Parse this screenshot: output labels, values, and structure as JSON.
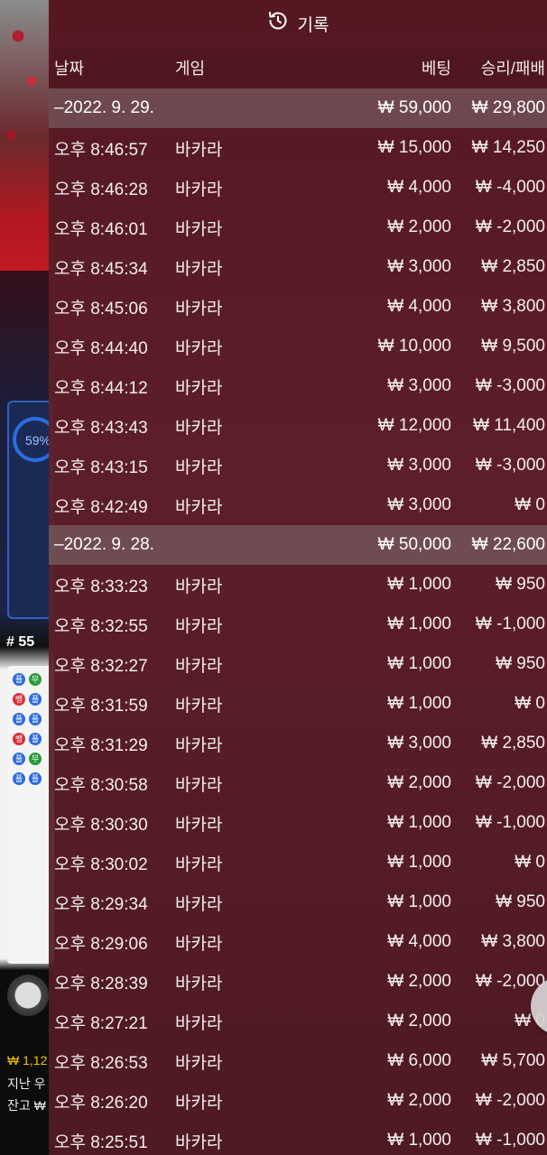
{
  "background": {
    "percent_label": "59%",
    "round_number": "# 55",
    "bead_road": [
      "플",
      "무",
      "뱅",
      "플",
      "플",
      "플",
      "뱅",
      "플",
      "플",
      "무",
      "플",
      "플"
    ],
    "balance_line1": "₩ 1,12",
    "balance_line2": "지난 우",
    "balance_line3": "잔고 ₩"
  },
  "panel": {
    "title": "기록",
    "title_icon": "history-clock-icon",
    "columns": {
      "date": "날짜",
      "game": "게임",
      "bet": "베팅",
      "win_loss": "승리/패배"
    }
  },
  "history_groups": [
    {
      "date": "–2022. 9. 29.",
      "total_bet": "₩ 59,000",
      "total_win": "₩ 29,800",
      "rows": [
        {
          "time": "오후 8:46:57",
          "game": "바카라",
          "bet": "₩ 15,000",
          "win": "₩ 14,250"
        },
        {
          "time": "오후 8:46:28",
          "game": "바카라",
          "bet": "₩ 4,000",
          "win": "₩ -4,000"
        },
        {
          "time": "오후 8:46:01",
          "game": "바카라",
          "bet": "₩ 2,000",
          "win": "₩ -2,000"
        },
        {
          "time": "오후 8:45:34",
          "game": "바카라",
          "bet": "₩ 3,000",
          "win": "₩ 2,850"
        },
        {
          "time": "오후 8:45:06",
          "game": "바카라",
          "bet": "₩ 4,000",
          "win": "₩ 3,800"
        },
        {
          "time": "오후 8:44:40",
          "game": "바카라",
          "bet": "₩ 10,000",
          "win": "₩ 9,500"
        },
        {
          "time": "오후 8:44:12",
          "game": "바카라",
          "bet": "₩ 3,000",
          "win": "₩ -3,000"
        },
        {
          "time": "오후 8:43:43",
          "game": "바카라",
          "bet": "₩ 12,000",
          "win": "₩ 11,400"
        },
        {
          "time": "오후 8:43:15",
          "game": "바카라",
          "bet": "₩ 3,000",
          "win": "₩ -3,000"
        },
        {
          "time": "오후 8:42:49",
          "game": "바카라",
          "bet": "₩ 3,000",
          "win": "₩ 0"
        }
      ]
    },
    {
      "date": "–2022. 9. 28.",
      "total_bet": "₩ 50,000",
      "total_win": "₩ 22,600",
      "rows": [
        {
          "time": "오후 8:33:23",
          "game": "바카라",
          "bet": "₩ 1,000",
          "win": "₩ 950"
        },
        {
          "time": "오후 8:32:55",
          "game": "바카라",
          "bet": "₩ 1,000",
          "win": "₩ -1,000"
        },
        {
          "time": "오후 8:32:27",
          "game": "바카라",
          "bet": "₩ 1,000",
          "win": "₩ 950"
        },
        {
          "time": "오후 8:31:59",
          "game": "바카라",
          "bet": "₩ 1,000",
          "win": "₩ 0"
        },
        {
          "time": "오후 8:31:29",
          "game": "바카라",
          "bet": "₩ 3,000",
          "win": "₩ 2,850"
        },
        {
          "time": "오후 8:30:58",
          "game": "바카라",
          "bet": "₩ 2,000",
          "win": "₩ -2,000"
        },
        {
          "time": "오후 8:30:30",
          "game": "바카라",
          "bet": "₩ 1,000",
          "win": "₩ -1,000"
        },
        {
          "time": "오후 8:30:02",
          "game": "바카라",
          "bet": "₩ 1,000",
          "win": "₩ 0"
        },
        {
          "time": "오후 8:29:34",
          "game": "바카라",
          "bet": "₩ 1,000",
          "win": "₩ 950"
        },
        {
          "time": "오후 8:29:06",
          "game": "바카라",
          "bet": "₩ 4,000",
          "win": "₩ 3,800"
        },
        {
          "time": "오후 8:28:39",
          "game": "바카라",
          "bet": "₩ 2,000",
          "win": "₩ -2,000"
        },
        {
          "time": "오후 8:27:21",
          "game": "바카라",
          "bet": "₩ 2,000",
          "win": "₩ 0"
        },
        {
          "time": "오후 8:26:53",
          "game": "바카라",
          "bet": "₩ 6,000",
          "win": "₩ 5,700"
        },
        {
          "time": "오후 8:26:20",
          "game": "바카라",
          "bet": "₩ 2,000",
          "win": "₩ -2,000"
        },
        {
          "time": "오후 8:25:51",
          "game": "바카라",
          "bet": "₩ 1,000",
          "win": "₩ -1,000"
        }
      ]
    }
  ],
  "close_button": {
    "icon": "close-icon"
  },
  "colors": {
    "panel_bg": "#5a1a24",
    "group_row_bg": "#8c8c8c",
    "close_bg": "#d7d2d4",
    "balance_yellow": "#f2c400"
  }
}
